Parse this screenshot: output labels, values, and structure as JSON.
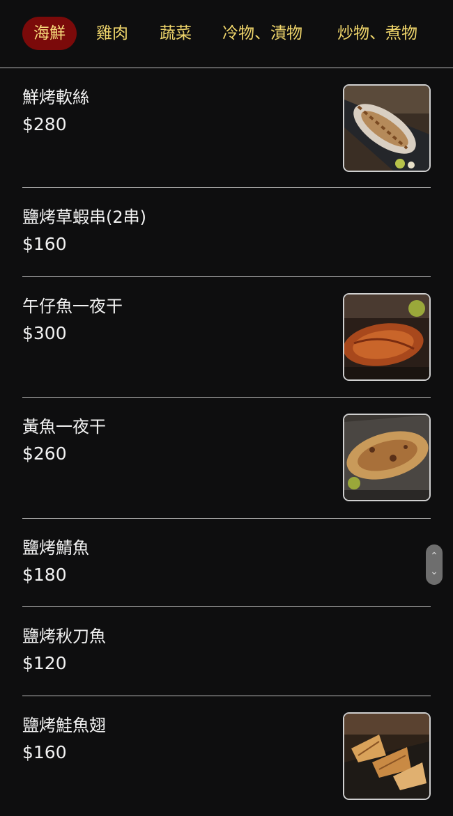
{
  "tabs": [
    {
      "label": "海鮮",
      "active": true
    },
    {
      "label": "雞肉",
      "active": false
    },
    {
      "label": "蔬菜",
      "active": false
    },
    {
      "label": "冷物、漬物",
      "active": false
    },
    {
      "label": "炒物、煮物",
      "active": false
    }
  ],
  "items": [
    {
      "name": "鮮烤軟絲",
      "price": "$280",
      "image": "grilled-squid-photo"
    },
    {
      "name": "鹽烤草蝦串(2串)",
      "price": "$160",
      "image": null
    },
    {
      "name": "午仔魚一夜干",
      "price": "$300",
      "image": "grilled-fish-photo"
    },
    {
      "name": "黃魚一夜干",
      "price": "$260",
      "image": "grilled-yellow-croaker-photo"
    },
    {
      "name": "鹽烤鯖魚",
      "price": "$180",
      "image": null
    },
    {
      "name": "鹽烤秋刀魚",
      "price": "$120",
      "image": null
    },
    {
      "name": "鹽烤鮭魚翅",
      "price": "$160",
      "image": "grilled-salmon-fin-photo"
    }
  ],
  "scroll_control": {
    "up_icon": "chevron-up-icon",
    "down_icon": "chevron-down-icon"
  },
  "colors": {
    "background": "#0e0e0f",
    "tab_text": "#f0d66b",
    "active_tab_bg": "#7b0a0a",
    "divider": "#bdbdbd"
  }
}
